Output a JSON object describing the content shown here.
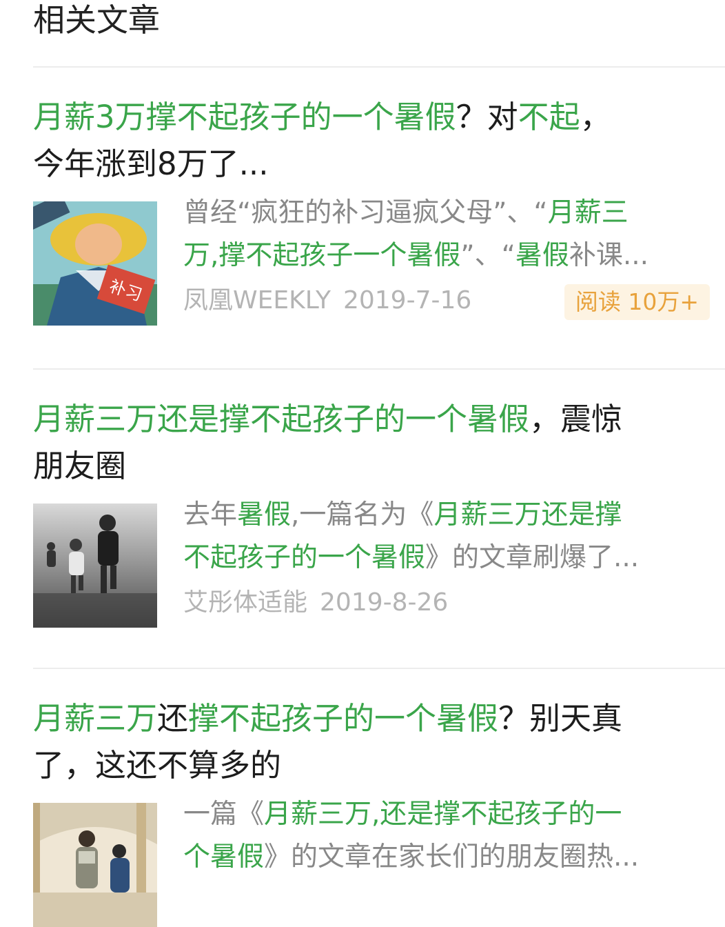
{
  "section": {
    "title": "相关文章"
  },
  "articles": [
    {
      "title": [
        {
          "t": "月薪3万撑不起孩子的一个暑假",
          "hl": true
        },
        {
          "t": "？对",
          "hl": false
        },
        {
          "t": "不起",
          "hl": true
        },
        {
          "t": "，\n今年涨到8万了...",
          "hl": false
        }
      ],
      "summary": [
        {
          "t": "曾经“疯狂的补习逼疯父母”、“",
          "hl": false
        },
        {
          "t": "月薪三\n万,撑不起孩子一个暑假",
          "hl": true
        },
        {
          "t": "”、“",
          "hl": false
        },
        {
          "t": "暑假",
          "hl": true
        },
        {
          "t": "补课...",
          "hl": false
        }
      ],
      "source": "凤凰WEEKLY",
      "date": "2019-7-16",
      "reads": "阅读 10万+",
      "thumb": "poster-illustration",
      "thumb_badge": "补习"
    },
    {
      "title": [
        {
          "t": "月薪三万还是撑不起孩子的一个暑假",
          "hl": true
        },
        {
          "t": "，震惊\n朋友圈",
          "hl": false
        }
      ],
      "summary": [
        {
          "t": "去年",
          "hl": false
        },
        {
          "t": "暑假",
          "hl": true
        },
        {
          "t": ",一篇名为《",
          "hl": false
        },
        {
          "t": "月薪三万还是撑\n不起孩子的一个暑假",
          "hl": true
        },
        {
          "t": "》的文章刷爆了...",
          "hl": false
        }
      ],
      "source": "艾彤体适能",
      "date": "2019-8-26",
      "reads": "",
      "thumb": "children-running-photo"
    },
    {
      "title": [
        {
          "t": "月薪三万",
          "hl": true
        },
        {
          "t": "还",
          "hl": false
        },
        {
          "t": "撑不起孩子的一个暑假",
          "hl": true
        },
        {
          "t": "？别天真\n了，这还不算多的",
          "hl": false
        }
      ],
      "summary": [
        {
          "t": "一篇《",
          "hl": false
        },
        {
          "t": "月薪三万,还是撑不起孩子的一\n个暑假",
          "hl": true
        },
        {
          "t": "》的文章在家长们的朋友圈热...",
          "hl": false
        }
      ],
      "source": "",
      "date": "",
      "reads": "",
      "thumb": "museum-photo"
    }
  ],
  "colors": {
    "highlight": "#3aa54a",
    "meta": "#b4b4b4",
    "reads_bg": "#fdf3e2",
    "reads_text": "#e8a23c"
  }
}
